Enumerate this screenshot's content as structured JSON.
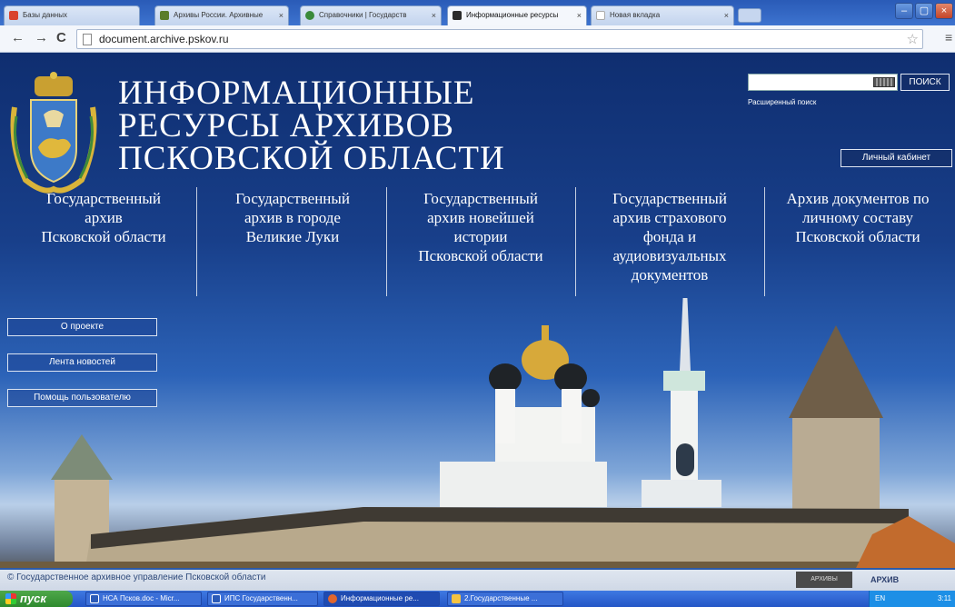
{
  "browser": {
    "tabs": [
      {
        "label": "Базы данных",
        "color": "#d9432e"
      },
      {
        "label": "Архивы России. Архивные",
        "color": "#5a7d2a"
      },
      {
        "label": "Справочники | Государств",
        "color": "#3a8a3a"
      },
      {
        "label": "Информационные ресурсы",
        "color": "#2b2b2b",
        "active": true
      },
      {
        "label": "Новая вкладка",
        "color": "#ffffff"
      }
    ],
    "url": "document.archive.pskov.ru",
    "close_glyph": "×"
  },
  "header": {
    "title_lines": [
      "ИНФОРМАЦИОННЫЕ",
      "РЕСУРСЫ  АРХИВОВ",
      "ПСКОВСКОЙ  ОБЛАСТИ"
    ],
    "search_button": "ПОИСК",
    "advanced_search": "Расширенный поиск",
    "cabinet_button": "Личный кабинет"
  },
  "archives": [
    "Государственный\nархив\nПсковской области",
    "Государственный\nархив в городе\nВеликие Луки",
    "Государственный\nархив новейшей\nистории\nПсковской области",
    "Государственный\nархив страхового\nфонда и\nаудиовизуальных\nдокументов",
    "Архив документов по\nличному составу\nПсковской области"
  ],
  "side_menu": [
    "О проекте",
    "Лента новостей",
    "Помощь пользователю"
  ],
  "footer": {
    "copyright": "© Государственное архивное управление Псковской области",
    "logo_1": "АРХИВЫ",
    "logo_2": "АРХИВ"
  },
  "taskbar": {
    "start": "пуск",
    "tasks": [
      {
        "label": "НСА Псков.doc - Micr...",
        "color": "#2b5ab8"
      },
      {
        "label": "ИПС Государственн...",
        "color": "#2b5ab8"
      },
      {
        "label": "Информационные ре...",
        "color": "#e0662e",
        "active": true
      },
      {
        "label": "2.Государственные ...",
        "color": "#f5c342"
      }
    ],
    "tray": "EN",
    "clock": "3:11"
  }
}
